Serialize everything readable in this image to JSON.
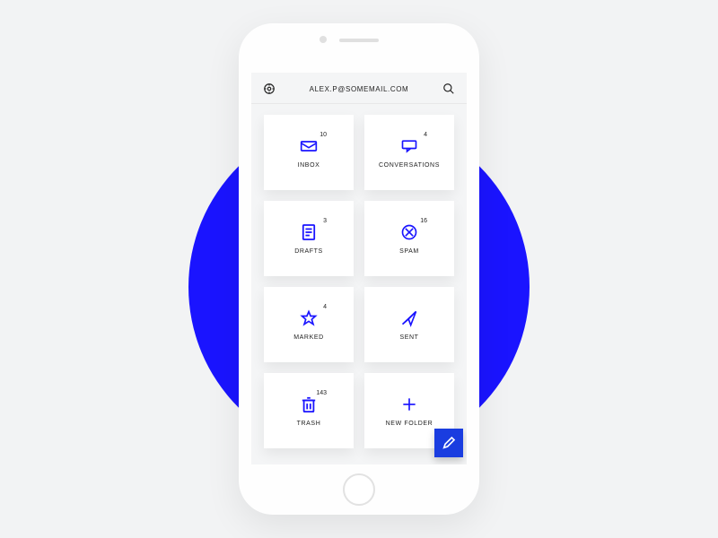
{
  "header": {
    "email": "ALEX.P@SOMEMAIL.COM"
  },
  "colors": {
    "accent": "#1a14ff",
    "fab": "#1a3de0"
  },
  "tiles": [
    {
      "label": "INBOX",
      "badge": "10",
      "icon": "envelope-icon"
    },
    {
      "label": "CONVERSATIONS",
      "badge": "4",
      "icon": "chat-icon"
    },
    {
      "label": "DRAFTS",
      "badge": "3",
      "icon": "document-icon"
    },
    {
      "label": "SPAM",
      "badge": "16",
      "icon": "blocked-icon"
    },
    {
      "label": "MARKED",
      "badge": "4",
      "icon": "star-icon"
    },
    {
      "label": "SENT",
      "badge": "",
      "icon": "send-icon"
    },
    {
      "label": "TRASH",
      "badge": "143",
      "icon": "trash-icon"
    },
    {
      "label": "NEW FOLDER",
      "badge": "",
      "icon": "plus-icon"
    }
  ]
}
